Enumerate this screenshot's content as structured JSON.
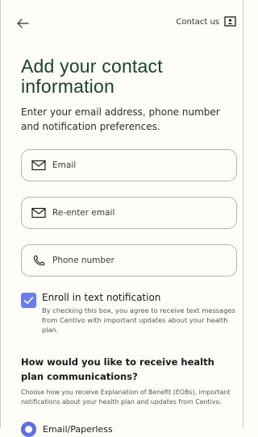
{
  "header": {
    "back_icon": "arrow-left-icon",
    "contact_label": "Contact us",
    "contact_icon": "contact-card-icon"
  },
  "title": "Add your contact information",
  "subtitle": "Enter your email address, phone number and notification preferences.",
  "fields": [
    {
      "placeholder": "Email",
      "icon": "mail-icon"
    },
    {
      "placeholder": "Re-enter email",
      "icon": "mail-icon"
    },
    {
      "placeholder": "Phone number",
      "icon": "phone-icon"
    }
  ],
  "text_notification": {
    "checked": true,
    "label": "Enroll in text notification",
    "help": "By checking this box, you agree to receive text messages from Centivo with important updates about your health plan."
  },
  "communications": {
    "question": "How would you like to receive health plan communications?",
    "help": "Choose how you receive Explanation of Benefit (EOBs), important notifications about your health plan and updates from Centivo.",
    "options": [
      {
        "label": "Email/Paperless",
        "selected": true
      }
    ]
  },
  "colors": {
    "title": "#17442d",
    "accent": "#6b7ef0",
    "background": "#fffdf8"
  }
}
